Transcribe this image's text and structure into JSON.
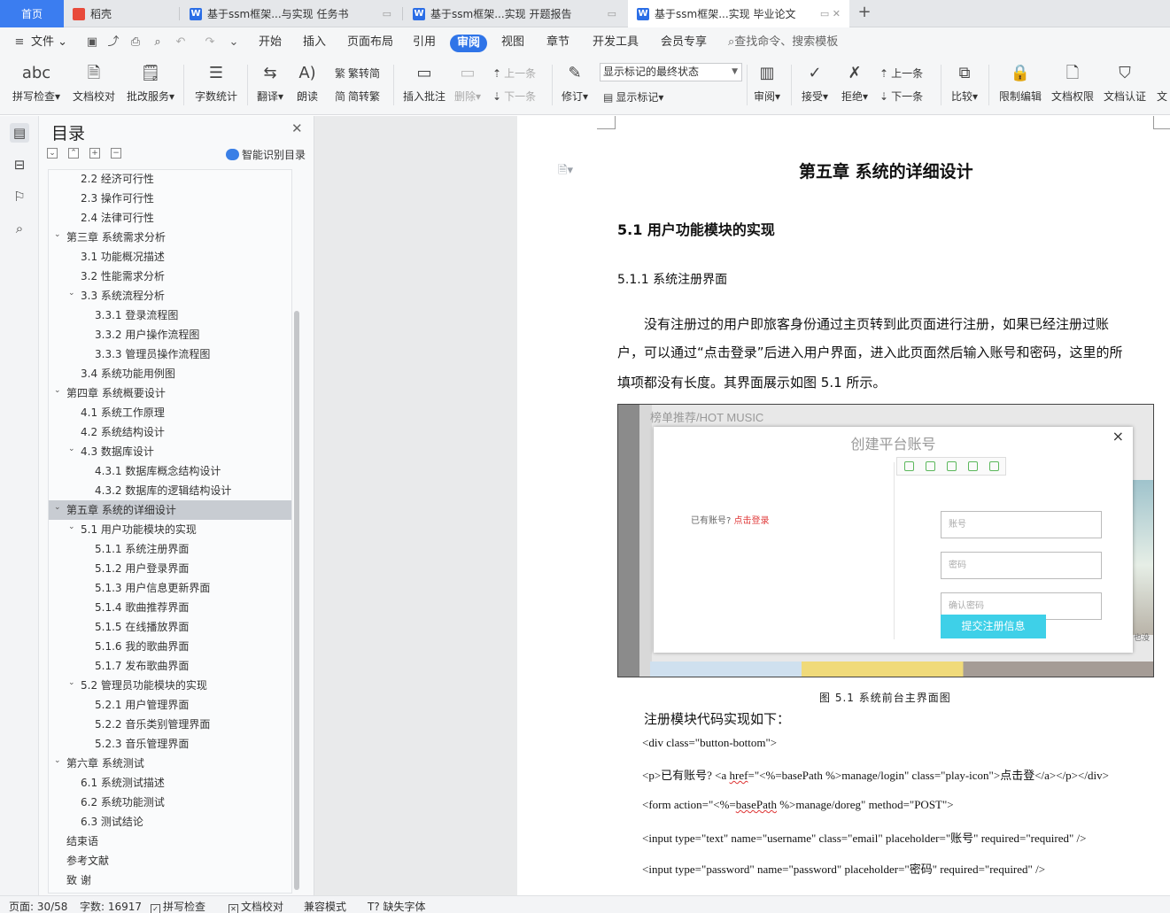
{
  "tabs": [
    {
      "label": "首页",
      "icon": "",
      "active": false
    },
    {
      "label": "稻壳",
      "icon": "docer-icon",
      "active": false
    },
    {
      "label": "基于ssm框架...与实现 任务书",
      "icon": "word-icon",
      "active": false
    },
    {
      "label": "基于ssm框架...实现 开题报告",
      "icon": "word-icon",
      "active": false
    },
    {
      "label": "基于ssm框架...实现 毕业论文",
      "icon": "word-icon",
      "active": true
    }
  ],
  "tab_icon_letter": "W",
  "menu": {
    "file": "文件",
    "items": [
      "开始",
      "插入",
      "页面布局",
      "引用",
      "审阅",
      "视图",
      "章节",
      "开发工具",
      "会员专享"
    ],
    "active": "审阅",
    "search": "查找命令、搜索模板"
  },
  "ribbon": {
    "spell": "拼写检查",
    "proof": "文档校对",
    "correct": "批改服务",
    "wordcount": "字数统计",
    "translate": "翻译",
    "read": "朗读",
    "trad": "繁转简",
    "simp": "简转繁",
    "insert_comment": "插入批注",
    "delete": "删除",
    "prev": "上一条",
    "next": "下一条",
    "revise": "修订",
    "markup_state": "显示标记的最终状态",
    "show_markup": "显示标记",
    "review": "审阅",
    "accept": "接受",
    "reject": "拒绝",
    "prev2": "上一条",
    "next2": "下一条",
    "compare": "比较",
    "restrict": "限制编辑",
    "perm": "文档权限",
    "cert": "文档认证",
    "trunc": "文"
  },
  "toc": {
    "title": "目录",
    "smart": "智能识别目录",
    "items": [
      {
        "text": "2.2  经济可行性",
        "level": 2,
        "caret": ""
      },
      {
        "text": "2.3  操作可行性",
        "level": 2,
        "caret": ""
      },
      {
        "text": "2.4  法律可行性",
        "level": 2,
        "caret": ""
      },
      {
        "text": "第三章  系统需求分析",
        "level": 1,
        "caret": "⌄"
      },
      {
        "text": "3.1  功能概况描述",
        "level": 2,
        "caret": ""
      },
      {
        "text": "3.2 性能需求分析",
        "level": 2,
        "caret": ""
      },
      {
        "text": "3.3 系统流程分析",
        "level": 2,
        "caret": "⌄"
      },
      {
        "text": "3.3.1 登录流程图",
        "level": 3,
        "caret": ""
      },
      {
        "text": "3.3.2 用户操作流程图",
        "level": 3,
        "caret": ""
      },
      {
        "text": "3.3.3 管理员操作流程图",
        "level": 3,
        "caret": ""
      },
      {
        "text": "3.4 系统功能用例图",
        "level": 2,
        "caret": ""
      },
      {
        "text": "第四章  系统概要设计",
        "level": 1,
        "caret": "⌄"
      },
      {
        "text": "4.1 系统工作原理",
        "level": 2,
        "caret": ""
      },
      {
        "text": "4.2  系统结构设计",
        "level": 2,
        "caret": ""
      },
      {
        "text": "4.3  数据库设计",
        "level": 2,
        "caret": "⌄"
      },
      {
        "text": "4.3.1 数据库概念结构设计",
        "level": 3,
        "caret": ""
      },
      {
        "text": "4.3.2 数据库的逻辑结构设计",
        "level": 3,
        "caret": ""
      },
      {
        "text": "第五章  系统的详细设计",
        "level": 1,
        "caret": "⌄",
        "selected": true
      },
      {
        "text": "5.1  用户功能模块的实现",
        "level": 2,
        "caret": "⌄"
      },
      {
        "text": "5.1.1 系统注册界面",
        "level": 3,
        "caret": ""
      },
      {
        "text": "5.1.2 用户登录界面",
        "level": 3,
        "caret": ""
      },
      {
        "text": "5.1.3 用户信息更新界面",
        "level": 3,
        "caret": ""
      },
      {
        "text": "5.1.4 歌曲推荐界面",
        "level": 3,
        "caret": ""
      },
      {
        "text": "5.1.5 在线播放界面",
        "level": 3,
        "caret": ""
      },
      {
        "text": "5.1.6 我的歌曲界面",
        "level": 3,
        "caret": ""
      },
      {
        "text": "5.1.7 发布歌曲界面",
        "level": 3,
        "caret": ""
      },
      {
        "text": "5.2  管理员功能模块的实现",
        "level": 2,
        "caret": "⌄"
      },
      {
        "text": "5.2.1 用户管理界面",
        "level": 3,
        "caret": ""
      },
      {
        "text": "5.2.2 音乐类别管理界面",
        "level": 3,
        "caret": ""
      },
      {
        "text": "5.2.3 音乐管理界面",
        "level": 3,
        "caret": ""
      },
      {
        "text": "第六章  系统测试",
        "level": 1,
        "caret": "⌄"
      },
      {
        "text": "6.1 系统测试描述",
        "level": 2,
        "caret": ""
      },
      {
        "text": "6.2 系统功能测试",
        "level": 2,
        "caret": ""
      },
      {
        "text": "6.3 测试结论",
        "level": 2,
        "caret": ""
      },
      {
        "text": "结束语",
        "level": 1,
        "caret": ""
      },
      {
        "text": "参考文献",
        "level": 1,
        "caret": ""
      },
      {
        "text": "致    谢",
        "level": 1,
        "caret": ""
      }
    ]
  },
  "doc": {
    "chapter": "第五章  系统的详细设计",
    "section": "5.1  用户功能模块的实现",
    "subsection": "5.1.1 系统注册界面",
    "para1": "没有注册过的用户即旅客身份通过主页转到此页面进行注册，如果已经注册过账",
    "para2": "户，可以通过“点击登录”后进入用户界面，进入此页面然后输入账号和密码，这里的所",
    "para3": "填项都没有长度。其界面展示如图 5.1 所示。",
    "figure": {
      "hot": "榜单推荐/HOT MUSIC",
      "title": "创建平台账号",
      "close": "×",
      "have_account": "已有账号? ",
      "login_link": "点击登录",
      "account_ph": "账号",
      "password_ph": "密码",
      "confirm_ph": "确认密码",
      "submit": "提交注册信息",
      "right_text": "也没"
    },
    "caption": "图 5.1 系统前台主界面图",
    "code_intro": "注册模块代码实现如下：",
    "code": [
      {
        "pre": "<div class=\"button-bottom\">",
        "mid": "",
        "post": ""
      },
      {
        "pre": "<p>已有账号? <a ",
        "mid": "href",
        "post": "=\"<%=basePath %>manage/login\" class=\"play-icon\">点击登</a></p></div>"
      },
      {
        "pre": "<form action=\"<%=",
        "mid": "basePath",
        "post": " %>manage/doreg\" method=\"POST\">"
      },
      {
        "pre": "<input type=\"text\" name=\"username\" class=\"email\" placeholder=\"账号\" required=\"required\" />",
        "mid": "",
        "post": ""
      },
      {
        "pre": "<input type=\"password\" name=\"password\" placeholder=\"密码\" required=\"required\" />",
        "mid": "",
        "post": ""
      }
    ]
  },
  "status": {
    "page": "页面: 30/58",
    "words": "字数: 16917",
    "spell": "拼写检查",
    "proof": "文档校对",
    "compat": "兼容模式",
    "missing_font": "缺失字体"
  }
}
